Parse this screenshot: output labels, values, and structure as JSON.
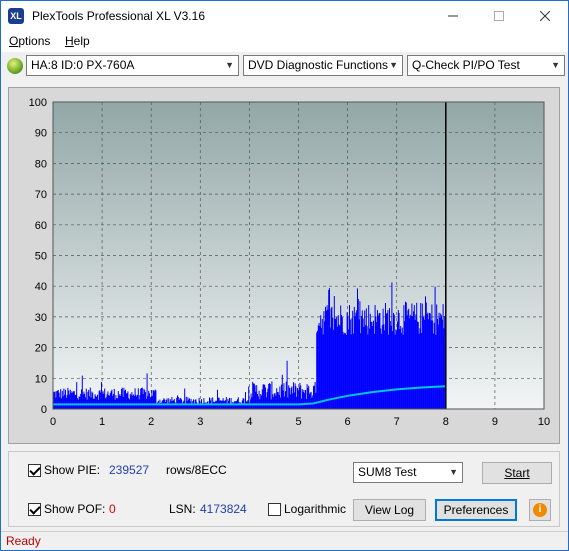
{
  "window": {
    "title": "PlexTools Professional XL V3.16",
    "icon_text": "XL"
  },
  "menu": [
    {
      "label": "Options",
      "accel": "O",
      "rest": "ptions"
    },
    {
      "label": "Help",
      "accel": "H",
      "rest": "elp"
    }
  ],
  "toolbar": {
    "drive": "HA:8 ID:0  PX-760A",
    "function": "DVD Diagnostic Functions",
    "test": "Q-Check PI/PO Test"
  },
  "chart_data": {
    "type": "bar",
    "xlim": [
      0,
      10
    ],
    "ylim": [
      0,
      100
    ],
    "x_ticks": [
      "0",
      "1",
      "2",
      "3",
      "4",
      "5",
      "6",
      "7",
      "8",
      "9",
      "10"
    ],
    "y_ticks": [
      "0",
      "10",
      "20",
      "30",
      "40",
      "50",
      "60",
      "70",
      "80",
      "90",
      "100"
    ],
    "grid": true,
    "scan_end_x": 8.0,
    "series": [
      {
        "segments": [
          {
            "x0": 0.0,
            "x1": 2.1,
            "base": 3,
            "max": 7,
            "spike_max": 14
          },
          {
            "x0": 2.1,
            "x1": 4.0,
            "base": 1.5,
            "max": 4,
            "spike_max": 8
          },
          {
            "x0": 4.0,
            "x1": 5.35,
            "base": 3,
            "max": 9,
            "spike_max": 16
          },
          {
            "x0": 5.35,
            "x1": 8.0,
            "base": 24,
            "max": 35,
            "spike_max": 43
          }
        ]
      },
      {
        "points": [
          [
            0,
            1.5
          ],
          [
            1,
            1.5
          ],
          [
            2,
            1.5
          ],
          [
            3,
            1.5
          ],
          [
            4,
            1.5
          ],
          [
            5,
            1.5
          ],
          [
            5.3,
            1.8
          ],
          [
            5.6,
            3.0
          ],
          [
            6,
            4.3
          ],
          [
            6.5,
            5.5
          ],
          [
            7,
            6.4
          ],
          [
            7.5,
            7.0
          ],
          [
            8,
            7.4
          ]
        ]
      }
    ]
  },
  "colors": {
    "pie_bars": "#0000ff",
    "pof_line": "#00c8e0",
    "plot_bg_top": "#93a7a7",
    "plot_bg_bottom": "#f2f5f5"
  },
  "stats": {
    "show_pie_label": "Show PIE:",
    "pie_value": "239527",
    "rows_label": "rows/8ECC",
    "show_pof_label": "Show POF:",
    "pof_value": "0",
    "lsn_label": "LSN:",
    "lsn_value": "4173824",
    "log_label": "Logarithmic"
  },
  "controls": {
    "sum_select": "SUM8 Test",
    "start": "Start",
    "view_log": "View Log",
    "preferences": "Preferences"
  },
  "status": "Ready"
}
